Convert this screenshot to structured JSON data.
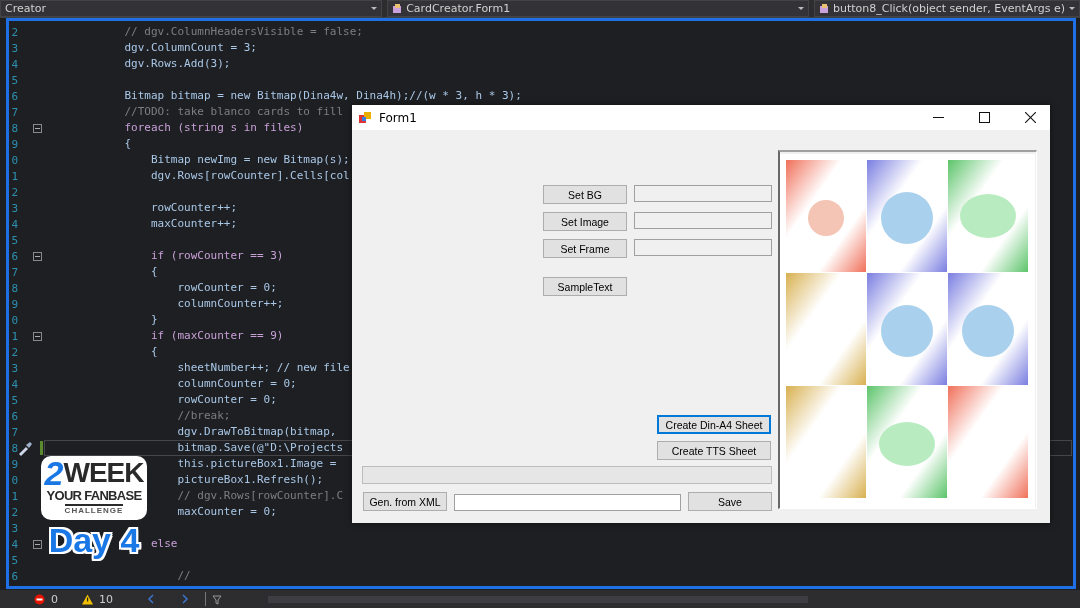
{
  "editor": {
    "nav": [
      {
        "text": "Creator",
        "icon": false
      },
      {
        "text": "CardCreator.Form1",
        "icon": true
      },
      {
        "text": "button8_Click(object sender, EventArgs e)",
        "icon": true
      }
    ],
    "lines": [
      {
        "number": "2",
        "text": "            // dgv.ColumnHeadersVisible = false;",
        "kind": "comment",
        "current": false
      },
      {
        "number": "3",
        "text": "            dgv.ColumnCount = 3;",
        "kind": "code",
        "current": false
      },
      {
        "number": "4",
        "text": "            dgv.Rows.Add(3);",
        "kind": "code",
        "current": false
      },
      {
        "number": "5",
        "current": false
      },
      {
        "number": "6",
        "text": "            Bitmap bitmap = new Bitmap(Dina4w, Dina4h);//(w * 3, h * 3);",
        "kind": "code",
        "current": false
      },
      {
        "number": "7",
        "text": "            //TODO: take blanco cards to fill",
        "kind": "comment",
        "current": false
      },
      {
        "number": "8",
        "text": "            foreach (string s in files)",
        "kind": "keyword",
        "current": false,
        "fold": true
      },
      {
        "number": "9",
        "text": "            {",
        "kind": "code",
        "current": false
      },
      {
        "number": "0",
        "text": "                Bitmap newImg = new Bitmap(s);",
        "kind": "code",
        "current": false
      },
      {
        "number": "1",
        "text": "                dgv.Rows[rowCounter].Cells[col",
        "kind": "code",
        "current": false
      },
      {
        "number": "2",
        "current": false
      },
      {
        "number": "3",
        "text": "                rowCounter++;",
        "kind": "code",
        "current": false
      },
      {
        "number": "4",
        "text": "                maxCounter++;",
        "kind": "code",
        "current": false
      },
      {
        "number": "5",
        "current": false
      },
      {
        "number": "6",
        "text": "                if (rowCounter == 3)",
        "kind": "keyword",
        "current": false,
        "fold": true
      },
      {
        "number": "7",
        "text": "                {",
        "kind": "code",
        "current": false
      },
      {
        "number": "8",
        "text": "                    rowCounter = 0;",
        "kind": "code",
        "current": false
      },
      {
        "number": "9",
        "text": "                    columnCounter++;",
        "kind": "code",
        "current": false
      },
      {
        "number": "0",
        "text": "                }",
        "kind": "code",
        "current": false
      },
      {
        "number": "1",
        "text": "                if (maxCounter == 9)",
        "kind": "keyword",
        "current": false,
        "fold": true
      },
      {
        "number": "2",
        "text": "                {",
        "kind": "code",
        "current": false
      },
      {
        "number": "3",
        "text": "                    sheetNumber++; // new file",
        "kind": "code",
        "current": false
      },
      {
        "number": "4",
        "text": "                    columnCounter = 0;",
        "kind": "code",
        "current": false
      },
      {
        "number": "5",
        "text": "                    rowCounter = 0;",
        "kind": "code",
        "current": false
      },
      {
        "number": "6",
        "text": "                    //break;",
        "kind": "comment",
        "current": false
      },
      {
        "number": "7",
        "text": "                    dgv.DrawToBitmap(bitmap,",
        "kind": "code",
        "current": false
      },
      {
        "number": "8",
        "text": "                    bitmap.Save(@\"D:\\Projects",
        "kind": "code",
        "current": true
      },
      {
        "number": "9",
        "text": "                    this.pictureBox1.Image =",
        "kind": "code",
        "current": false
      },
      {
        "number": "0",
        "text": "                    pictureBox1.Refresh();",
        "kind": "code",
        "current": false
      },
      {
        "number": "1",
        "text": "                    // dgv.Rows[rowCounter].C",
        "kind": "comment",
        "current": false
      },
      {
        "number": "2",
        "text": "                    maxCounter = 0;",
        "kind": "code",
        "current": false
      },
      {
        "number": "3",
        "current": false
      },
      {
        "number": "4",
        "text": "                else",
        "kind": "keyword",
        "current": false,
        "fold": true
      },
      {
        "number": "5",
        "current": false
      },
      {
        "number": "6",
        "text": "                    //",
        "kind": "comment",
        "current": false
      }
    ],
    "status": {
      "errors": "0",
      "warnings": "10"
    }
  },
  "form": {
    "title": "Form1",
    "controls": [
      {
        "kind": "button",
        "label": "Set BG",
        "focused": false
      },
      {
        "kind": "field"
      },
      {
        "kind": "button",
        "label": "Set Image",
        "focused": false
      },
      {
        "kind": "field"
      },
      {
        "kind": "button",
        "label": "Set Frame",
        "focused": false
      },
      {
        "kind": "field"
      },
      {
        "kind": "button",
        "label": "SampleText",
        "focused": false
      },
      {
        "kind": "button",
        "label": "Create Din-A4 Sheet",
        "focused": true
      },
      {
        "kind": "button",
        "label": "Create TTS Sheet",
        "focused": false
      },
      {
        "kind": "progress",
        "level": 0
      },
      {
        "kind": "button",
        "label": "Gen. from XML",
        "focused": false
      },
      {
        "kind": "field"
      },
      {
        "kind": "button",
        "label": "Save",
        "focused": false
      }
    ]
  },
  "logo": {
    "number": "2",
    "word": "WEEK",
    "line": "YOUR FANBASE",
    "tag": "CHALLENGE",
    "day": "Day 4"
  }
}
